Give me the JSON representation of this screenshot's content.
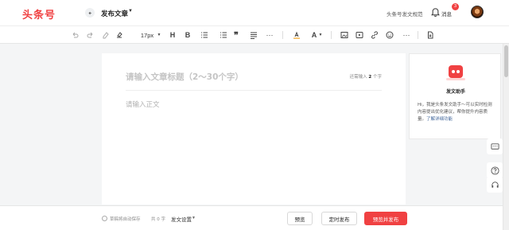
{
  "header": {
    "logo": "头条号",
    "page_title": "发布文章",
    "norms_link": "头条号发文规范",
    "messages_label": "消息",
    "messages_badge": "3"
  },
  "toolbar": {
    "font_size": "17px",
    "heading_label": "H",
    "bold_label": "B",
    "quote_label": "❞",
    "text_color_label": "A"
  },
  "editor": {
    "title_placeholder": "请输入文章标题（2～30个字）",
    "counter_prefix": "还需输入",
    "counter_value": "2",
    "counter_suffix": "个字",
    "body_placeholder": "请输入正文"
  },
  "assistant": {
    "name": "发文助手",
    "description": "Hi，我是头条发文助手～可以实时检测内容提出优化建议，帮你提升内容质量。",
    "link": "了解详细功能"
  },
  "bottom": {
    "autosave": "草稿将自动保存",
    "word_count": "共 0 字",
    "settings": "发文设置",
    "preview": "预览",
    "schedule": "定时发布",
    "publish": "预览并发布"
  },
  "colors": {
    "brand": "#f04142",
    "link": "#406599"
  }
}
